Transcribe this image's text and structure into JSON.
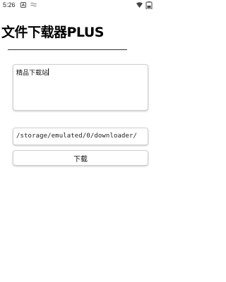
{
  "status_bar": {
    "time": "5:26",
    "icons": [
      "app-a-icon",
      "notification-icon",
      "wifi-icon",
      "battery-icon"
    ]
  },
  "app": {
    "title": "文件下载器PLUS"
  },
  "text_area": {
    "value": "精品下载站"
  },
  "path_field": {
    "value": "/storage/emulated/0/downloader/"
  },
  "download_button": {
    "label": "下载"
  }
}
